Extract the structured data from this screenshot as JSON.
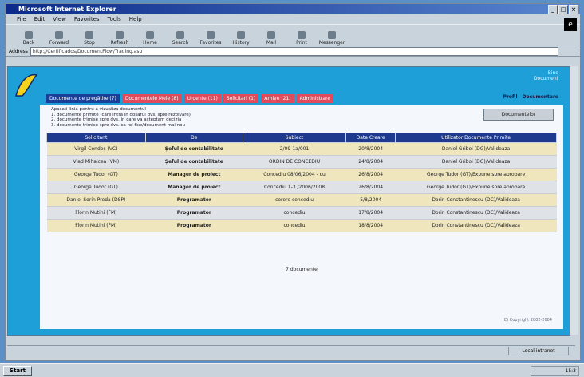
{
  "window": {
    "title": "Microsoft Internet Explorer"
  },
  "menu": [
    "File",
    "Edit",
    "View",
    "Favorites",
    "Tools",
    "Help"
  ],
  "toolbar": [
    "Back",
    "Forward",
    "Stop",
    "Refresh",
    "Home",
    "Search",
    "Favorites",
    "History",
    "Mail",
    "Print",
    "Messenger"
  ],
  "address": {
    "label": "Address",
    "value": "http://Certificados/DocumentFlow/Trading.asp"
  },
  "site": {
    "header_right": [
      "Bine",
      "Documenț"
    ],
    "tabs": [
      "Documente de pregătire (7)",
      "Documentele Mele (8)",
      "Urgente (11)",
      "Solicitari (1)",
      "Arhive (21)",
      "Administrare"
    ],
    "nav_right": [
      "Profil",
      "Documentare"
    ],
    "legend": [
      "Apasati linia pentru a vizualiza documentul",
      "1. documente primite (care intra in dosarul dvs. spre rezolvare)",
      "2. documente trimise spre dvs. in care va asteptam decizia",
      "3. documente trimise spre dvs. ca rol fixe/document mai nou"
    ],
    "download_button": "Documentelor",
    "table": {
      "headers": [
        "Solicitant",
        "De",
        "Subiect",
        "Data Creare",
        "Utilizator Documente Primite"
      ],
      "rows": [
        [
          "Virgil Condeș (VC)",
          "Șeful de contabilitate",
          "2/09-1a/001",
          "20/8/2004",
          "Daniel Griboi (DG)/Valideaza"
        ],
        [
          "Vlad Mihalcea (VM)",
          "Șeful de contabilitate",
          "ORDIN DE CONCEDIU",
          "24/8/2004",
          "Daniel Griboi (DG)/Valideaza"
        ],
        [
          "George Tudor (GT)",
          "Manager de proiect",
          "Concediu 08/06/2004 - cu",
          "26/8/2004",
          "George Tudor (GT)/Expune spre aprobare"
        ],
        [
          "George Tudor (GT)",
          "Manager de proiect",
          "Concediu 1-3 /2006/2008",
          "26/8/2004",
          "George Tudor (GT)/Expune spre aprobare"
        ],
        [
          "Daniel Sorin Preda (DSP)",
          "Programator",
          "cerere concediu",
          "5/8/2004",
          "Dorin Constantinescu (DC)/Valideaza"
        ],
        [
          "Florin Mutihi (FM)",
          "Programator",
          "concediu",
          "17/8/2004",
          "Dorin Constantinescu (DC)/Valideaza"
        ],
        [
          "Florin Mutihi (FM)",
          "Programator",
          "concediu",
          "18/8/2004",
          "Dorin Constantinescu (DC)/Valideaza"
        ]
      ]
    },
    "count": "7 documente",
    "copyright": "(C) Copyright 2002-2004"
  },
  "status": {
    "zone": "Local intranet"
  },
  "taskbar": {
    "start": "Start",
    "clock": "15:3"
  }
}
